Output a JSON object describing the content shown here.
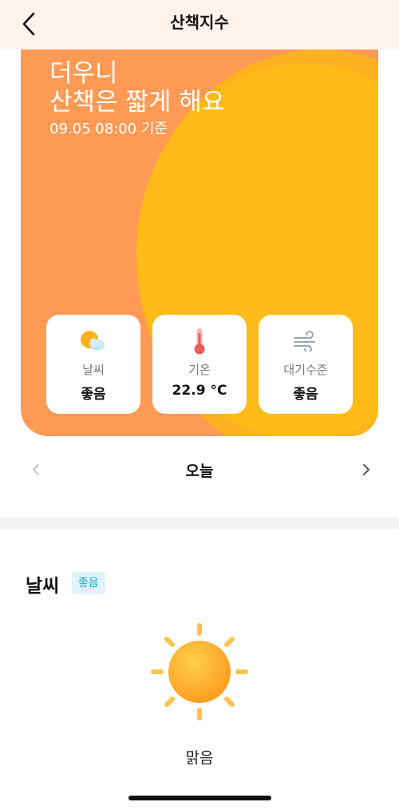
{
  "header": {
    "title": "산책지수"
  },
  "hero": {
    "line1": "더우니",
    "line2": "산책은 짧게 해요",
    "time": "09.05 08:00 기준"
  },
  "cards": [
    {
      "label": "날씨",
      "value": "좋음",
      "icon": "partly-cloudy-icon"
    },
    {
      "label": "기온",
      "value": "22.9 °C",
      "icon": "thermometer-icon"
    },
    {
      "label": "대기수준",
      "value": "좋음",
      "icon": "wind-icon"
    }
  ],
  "day_nav": {
    "label": "오늘"
  },
  "weather_section": {
    "title": "날씨",
    "badge": "좋음",
    "condition": "맑음",
    "icon": "sun-icon"
  },
  "colors": {
    "hero_orange": "#ff9a55",
    "sun_yellow": "#ffb21f",
    "badge_bg": "#dff3fb",
    "badge_text": "#28a9d3"
  }
}
